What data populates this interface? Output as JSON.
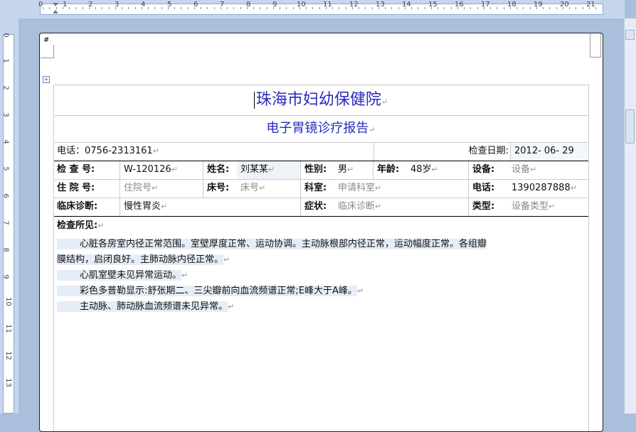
{
  "ruler_top": [
    "0",
    "1",
    "2",
    "3",
    "4",
    "5",
    "6",
    "7",
    "8",
    "9",
    "10",
    "11",
    "12",
    "13",
    "14",
    "15",
    "16",
    "17",
    "18",
    "19",
    "20",
    "21"
  ],
  "ruler_left": [
    "0",
    "1",
    "2",
    "3",
    "4",
    "5",
    "6",
    "7",
    "8",
    "9",
    "10",
    "11",
    "12",
    "13"
  ],
  "header_mark": "#",
  "doc": {
    "title": "珠海市妇幼保健院",
    "subtitle": "电子胃镜诊疗报告",
    "phone": "电话：0756-2313161",
    "exam_date_label": "检查日期:",
    "exam_date_value": "2012- 06- 29",
    "row1": {
      "l1": "检 查 号:",
      "v1": "W-120126",
      "l2": "姓名:",
      "v2": "刘某某",
      "l3": "性别:",
      "v3": "男",
      "l4": "年龄:",
      "v4": "48岁",
      "l5": "设备:",
      "v5": "设备"
    },
    "row2": {
      "l1": "住 院 号:",
      "v1": "住院号",
      "l2": "床号:",
      "v2": "床号",
      "l3": "科室:",
      "v3": "申请科室",
      "l4": "电话:",
      "v4": "1390287888"
    },
    "row3": {
      "l1": "临床诊断:",
      "v1": "慢性胃炎",
      "l2": "症状:",
      "v2": "临床诊断",
      "l3": "类型:",
      "v3": "设备类型"
    },
    "findings_label": "检查所见:",
    "findings": [
      "心脏各房室内径正常范围。室壁厚度正常、运动协调。主动脉根部内径正常，运动幅度正常。各组瓣",
      "膜结构，启闭良好。主肺动脉内径正常。",
      "心肌室壁未见异常运动。",
      "彩色多普勒显示:舒张期二、三尖瓣前向血流频谱正常;E峰大于A峰。",
      "主动脉、肺动脉血流频谱未见异常。"
    ]
  },
  "pilcrow": "↵"
}
